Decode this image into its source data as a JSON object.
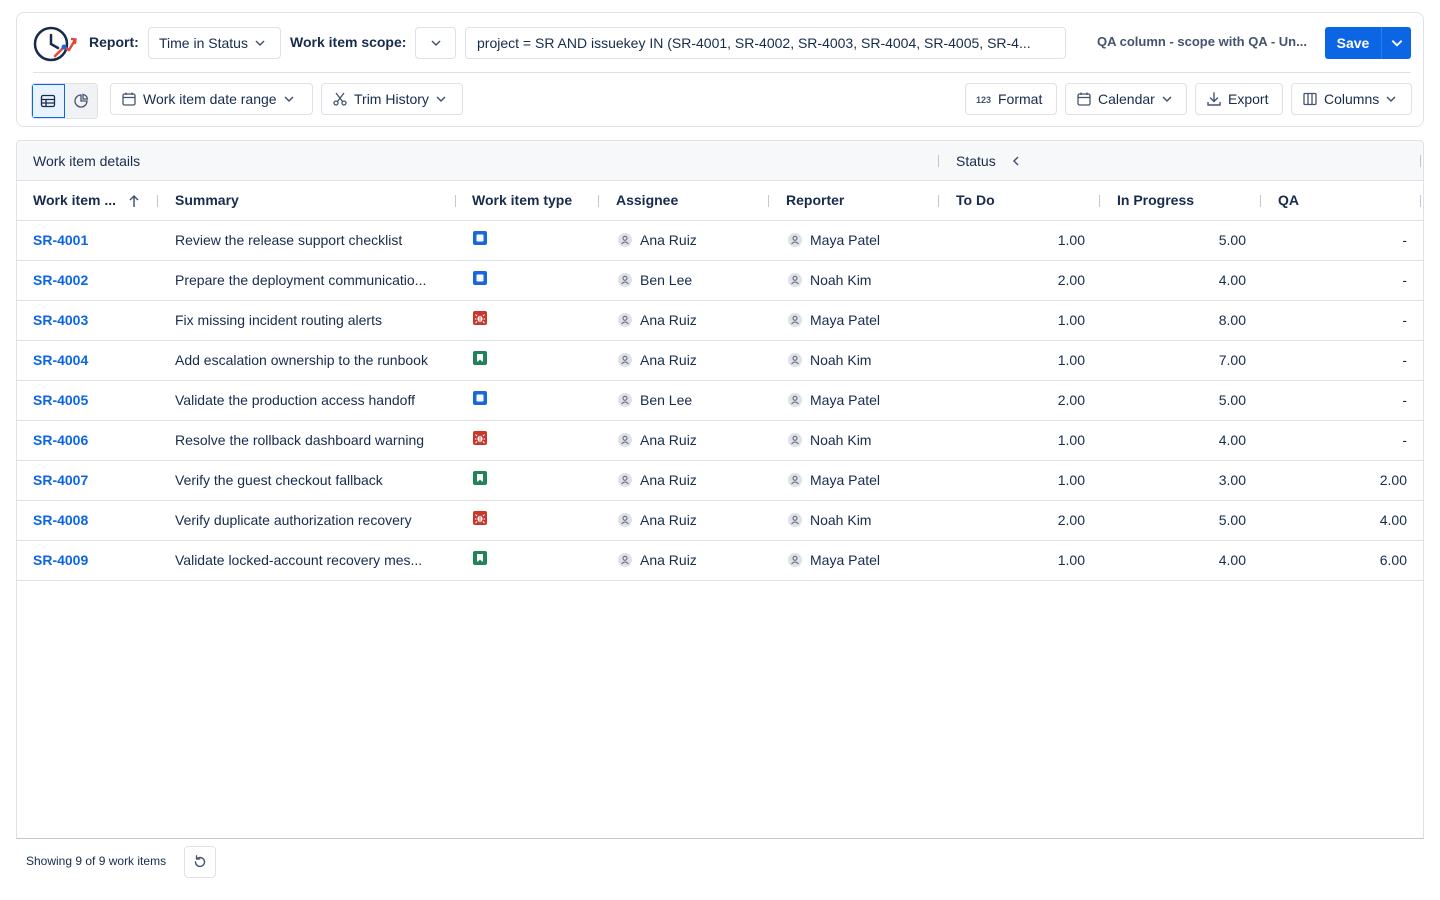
{
  "header": {
    "report_label": "Report:",
    "report_value": "Time in Status",
    "scope_label": "Work item scope:",
    "scope_query": "project = SR AND issuekey IN (SR-4001, SR-4002, SR-4003, SR-4004, SR-4005, SR-4...",
    "preset_name": "QA column - scope with QA - Un...",
    "save_label": "Save"
  },
  "filters": {
    "date_range_label": "Work item date range",
    "trim_history_label": "Trim History",
    "format_label": "Format",
    "calendar_label": "Calendar",
    "export_label": "Export",
    "columns_label": "Columns"
  },
  "table": {
    "group_details": "Work item details",
    "group_status": "Status",
    "columns": {
      "key": "Work item ...",
      "summary": "Summary",
      "type": "Work item type",
      "assignee": "Assignee",
      "reporter": "Reporter",
      "todo": "To Do",
      "inprogress": "In Progress",
      "qa": "QA"
    },
    "rows": [
      {
        "key": "SR-4001",
        "summary": "Review the release support checklist",
        "type": "task",
        "assignee": "Ana Ruiz",
        "reporter": "Maya Patel",
        "todo": "1.00",
        "inprogress": "5.00",
        "qa": "-"
      },
      {
        "key": "SR-4002",
        "summary": "Prepare the deployment communicatio...",
        "type": "task",
        "assignee": "Ben Lee",
        "reporter": "Noah Kim",
        "todo": "2.00",
        "inprogress": "4.00",
        "qa": "-"
      },
      {
        "key": "SR-4003",
        "summary": "Fix missing incident routing alerts",
        "type": "bug",
        "assignee": "Ana Ruiz",
        "reporter": "Maya Patel",
        "todo": "1.00",
        "inprogress": "8.00",
        "qa": "-"
      },
      {
        "key": "SR-4004",
        "summary": "Add escalation ownership to the runbook",
        "type": "story",
        "assignee": "Ana Ruiz",
        "reporter": "Noah Kim",
        "todo": "1.00",
        "inprogress": "7.00",
        "qa": "-"
      },
      {
        "key": "SR-4005",
        "summary": "Validate the production access handoff",
        "type": "task",
        "assignee": "Ben Lee",
        "reporter": "Maya Patel",
        "todo": "2.00",
        "inprogress": "5.00",
        "qa": "-"
      },
      {
        "key": "SR-4006",
        "summary": "Resolve the rollback dashboard warning",
        "type": "bug",
        "assignee": "Ana Ruiz",
        "reporter": "Noah Kim",
        "todo": "1.00",
        "inprogress": "4.00",
        "qa": "-"
      },
      {
        "key": "SR-4007",
        "summary": "Verify the guest checkout fallback",
        "type": "story",
        "assignee": "Ana Ruiz",
        "reporter": "Maya Patel",
        "todo": "1.00",
        "inprogress": "3.00",
        "qa": "2.00"
      },
      {
        "key": "SR-4008",
        "summary": "Verify duplicate authorization recovery",
        "type": "bug",
        "assignee": "Ana Ruiz",
        "reporter": "Noah Kim",
        "todo": "2.00",
        "inprogress": "5.00",
        "qa": "4.00"
      },
      {
        "key": "SR-4009",
        "summary": "Validate locked-account recovery mes...",
        "type": "story",
        "assignee": "Ana Ruiz",
        "reporter": "Maya Patel",
        "todo": "1.00",
        "inprogress": "4.00",
        "qa": "6.00"
      }
    ]
  },
  "footer": {
    "showing_text": "Showing 9 of 9 work items"
  },
  "colors": {
    "accent": "#0c66e4",
    "task": "#1868db",
    "bug": "#c9372c",
    "story": "#1f845a"
  }
}
